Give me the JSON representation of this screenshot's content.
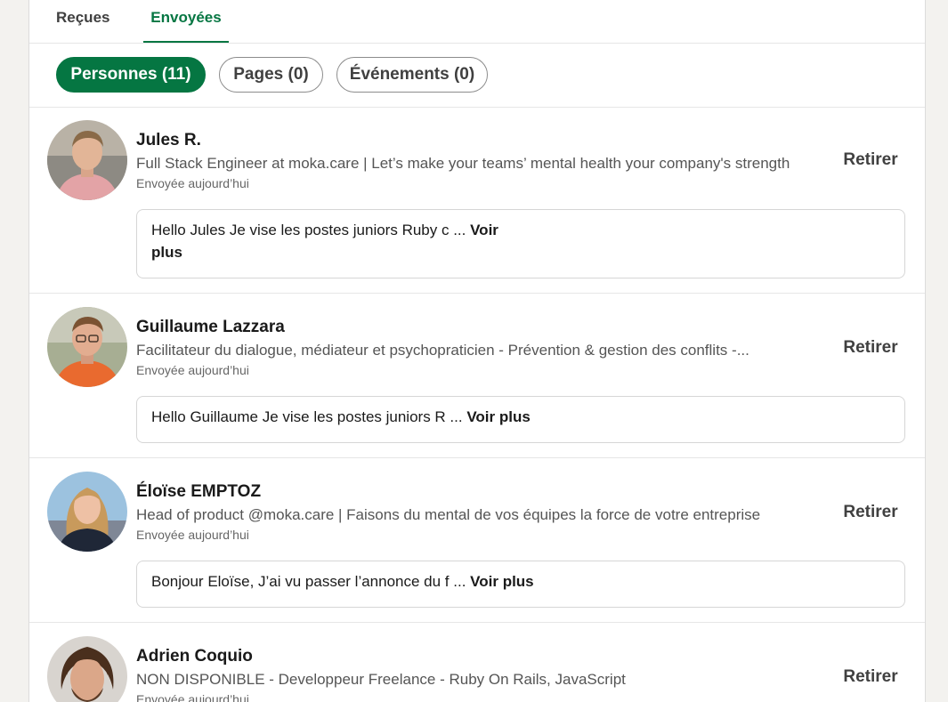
{
  "tabs": {
    "received": "Reçues",
    "sent": "Envoyées"
  },
  "filters": {
    "people": "Personnes (11)",
    "pages": "Pages (0)",
    "events": "Événements (0)"
  },
  "accent_color": "#057642",
  "invitations": [
    {
      "name": "Jules R.",
      "headline": "Full Stack Engineer at moka.care | Let’s make your teams’ mental health your company's strength",
      "sent": "Envoyée aujourd’hui",
      "action": "Retirer",
      "message": "Hello Jules Je vise les postes juniors Ruby c ...",
      "more_part1": "Voir",
      "more_part2": "plus"
    },
    {
      "name": "Guillaume Lazzara",
      "headline": "Facilitateur du dialogue, médiateur et psychopraticien - Prévention & gestion des conflits -...",
      "sent": "Envoyée aujourd’hui",
      "action": "Retirer",
      "message": "Hello Guillaume Je vise les postes juniors R ...",
      "more": "Voir plus"
    },
    {
      "name": "Éloïse EMPTOZ",
      "headline": "Head of product @moka.care | Faisons du mental de vos équipes la force de votre entreprise",
      "sent": "Envoyée aujourd’hui",
      "action": "Retirer",
      "message": "Bonjour Eloïse, J’ai vu passer l’annonce du f ...",
      "more": "Voir plus"
    },
    {
      "name": "Adrien Coquio",
      "headline": "NON DISPONIBLE - Developpeur Freelance - Ruby On Rails, JavaScript",
      "sent": "Envoyée aujourd’hui",
      "action": "Retirer"
    }
  ]
}
